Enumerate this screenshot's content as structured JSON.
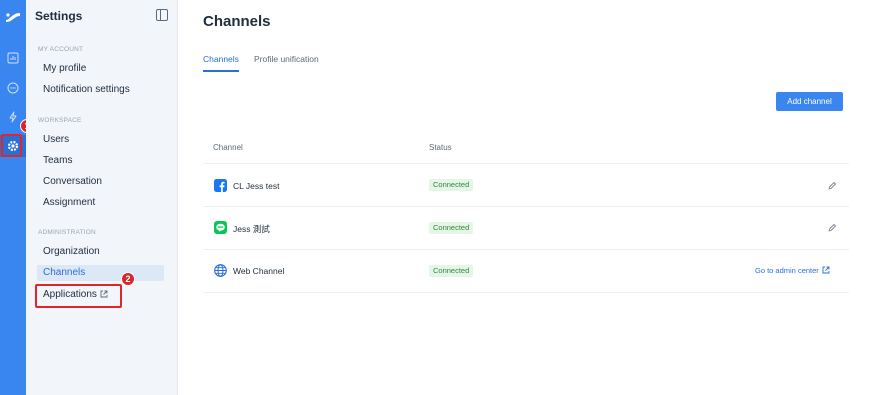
{
  "rail": {
    "icons": [
      "logo-icon",
      "analytics-icon",
      "chat-icon",
      "automation-icon",
      "settings-icon"
    ],
    "annotation_1": "1",
    "annotation_2": "2",
    "accent": "#3a86f0",
    "highlight": "#e0262b"
  },
  "sidebar": {
    "title": "Settings",
    "sections": {
      "my_account": "MY ACCOUNT",
      "workspace": "WORKSPACE",
      "administration": "ADMINISTRATION"
    },
    "items": {
      "my_profile": "My profile",
      "notification_settings": "Notification settings",
      "users": "Users",
      "teams": "Teams",
      "conversation": "Conversation",
      "assignment": "Assignment",
      "organization": "Organization",
      "channels": "Channels",
      "applications": "Applications"
    }
  },
  "main": {
    "title": "Channels",
    "tabs": [
      "Channels",
      "Profile unification"
    ],
    "add_button": "Add channel",
    "columns": {
      "channel": "Channel",
      "status": "Status"
    },
    "rows": [
      {
        "icon": "facebook-icon",
        "name": "CL Jess test",
        "status": "Connected",
        "action": "edit-icon"
      },
      {
        "icon": "line-icon",
        "name": "Jess 測試",
        "status": "Connected",
        "action": "edit-icon"
      },
      {
        "icon": "globe-icon",
        "name": "Web Channel",
        "status": "Connected",
        "action_label": "Go to admin center"
      }
    ]
  }
}
